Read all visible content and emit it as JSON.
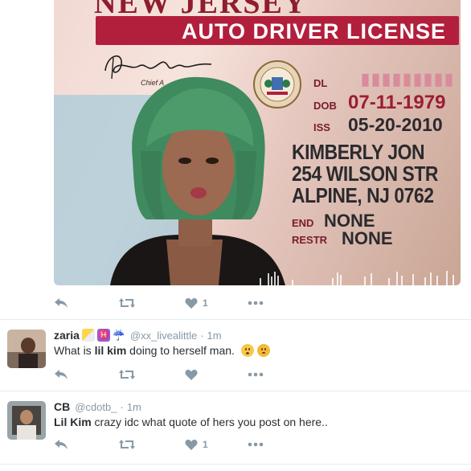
{
  "media": {
    "state": "NEW JERSEY",
    "banner": "AUTO DRIVER LICENSE",
    "chief_label": "Chief A",
    "dl_label": "DL",
    "dob_label": "DOB",
    "dob_value": "07-11-1979",
    "iss_label": "ISS",
    "iss_value": "05-20-2010",
    "name_line": "KIMBERLY JON",
    "address_line1": "254 WILSON STR",
    "address_line2": "ALPINE, NJ 0762",
    "end_label": "END",
    "end_value": "NONE",
    "restr_label": "RESTR",
    "restr_value": "NONE"
  },
  "first_actions": {
    "like_count": "1"
  },
  "tweets": [
    {
      "name": "zaria",
      "handle": "@xx_livealittle",
      "dot": "·",
      "time": "1m",
      "text_before": "What is ",
      "text_bold": "lil kim",
      "text_after": " doing to herself man.",
      "like_count": ""
    },
    {
      "name": "CB",
      "handle": "@cdotb_",
      "dot": "·",
      "time": "1m",
      "text_before": "",
      "text_bold": "Lil Kim",
      "text_after": " crazy idc what quote of hers you post on here..",
      "like_count": "1"
    }
  ],
  "colors": {
    "muted": "#8899a6",
    "text": "#292f33",
    "banner_red": "#b21f3c",
    "divider": "#e6ecf0"
  },
  "icons": [
    "reply-icon",
    "retweet-icon",
    "like-icon",
    "more-icon"
  ]
}
